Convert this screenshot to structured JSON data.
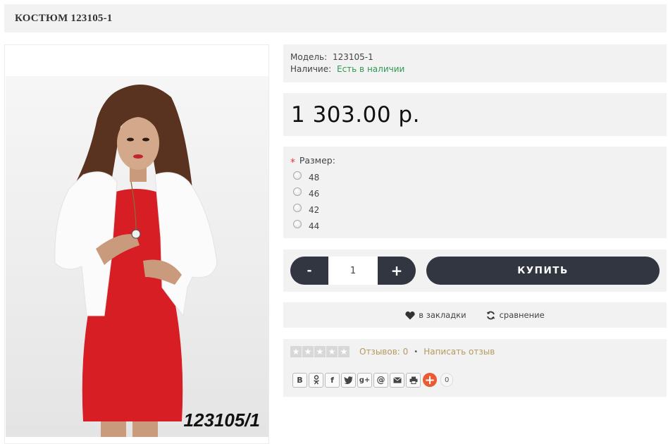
{
  "product": {
    "title": "КОСТЮМ 123105-1",
    "photo_caption": "123105/1"
  },
  "info": {
    "model_label": "Модель:",
    "model_value": "123105-1",
    "stock_label": "Наличие:",
    "stock_value": "Есть в наличии"
  },
  "price": "1 303.00 р.",
  "options": {
    "required_mark": "*",
    "size_label": "Размер:",
    "sizes": [
      "48",
      "46",
      "42",
      "44"
    ]
  },
  "cart": {
    "minus_label": "-",
    "plus_label": "+",
    "quantity": "1",
    "buy_label": "КУПИТЬ"
  },
  "actions": {
    "wishlist_label": "в закладки",
    "compare_label": "сравнение"
  },
  "reviews": {
    "stars_filled": 0,
    "stars_total": 5,
    "reviews_link": "Отзывов: 0",
    "separator": "•",
    "write_review": "Написать отзыв"
  },
  "share": {
    "buttons": [
      "В",
      "ok",
      "f",
      "tw",
      "g+",
      "@",
      "mail",
      "print"
    ],
    "count": "0"
  },
  "colors": {
    "panel_bg": "#f2f2f2",
    "button_dark": "#323641",
    "stock_green": "#2e9a4f",
    "link_gold": "#b49a5e",
    "share_plus": "#ec5a35",
    "dress_red": "#d61e24"
  }
}
